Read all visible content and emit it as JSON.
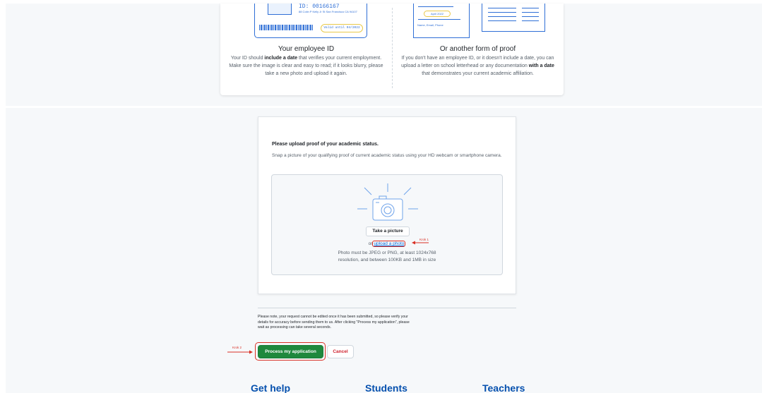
{
  "proof": {
    "employee_id": {
      "title": "Your employee ID",
      "desc_1": "Your ID should ",
      "desc_bold": "include a date",
      "desc_2": " that verifies your current employment. Make sure the image is clear and easy to read; if it looks blurry, please take a new photo and upload it again.",
      "card_number": "ID: 00166167",
      "card_address": "88 Colin P Kelly Jr St San Francisco CA 94107",
      "card_valid": "Valid until 04/2022"
    },
    "other_proof": {
      "title": "Or another form of proof",
      "desc_1": "If you don't have an employee ID, or it doesn't include a date, you can upload a letter on school letterhead or any documentation ",
      "desc_bold": "with a date",
      "desc_2": " that demonstrates your current academic affiliation.",
      "letter_date": "April 2022",
      "letter_footer": "Name, Email, Phone"
    }
  },
  "upload": {
    "heading": "Please upload proof of your academic status.",
    "description": "Snap a picture of your qualifying proof of current academic status using your HD webcam or smartphone camera.",
    "take_picture": "Take a picture",
    "or": "or",
    "upload_link": "upload a photo",
    "krok1": "Krok 1",
    "requirements_line1": "Photo must be JPEG or PNG, at least 1024x768",
    "requirements_line2": "resolution, and between 100KB and 1MB in size"
  },
  "submit": {
    "note": "Please note, your request cannot be edited once it has been submitted, so please verify your details for accuracy before sending them to us. After clicking \"Process my application\", please wait as processing can take several seconds.",
    "process_label": "Process my application",
    "cancel_label": "Cancel",
    "krok2": "Krok 2"
  },
  "footer": {
    "get_help": "Get help",
    "students": "Students",
    "teachers": "Teachers"
  },
  "colors": {
    "primary_green": "#1f883d",
    "link_blue": "#0969da",
    "annotation_red": "#d93025",
    "illustration_blue": "#2f6fd6",
    "highlight_yellow": "#e9c94a"
  }
}
